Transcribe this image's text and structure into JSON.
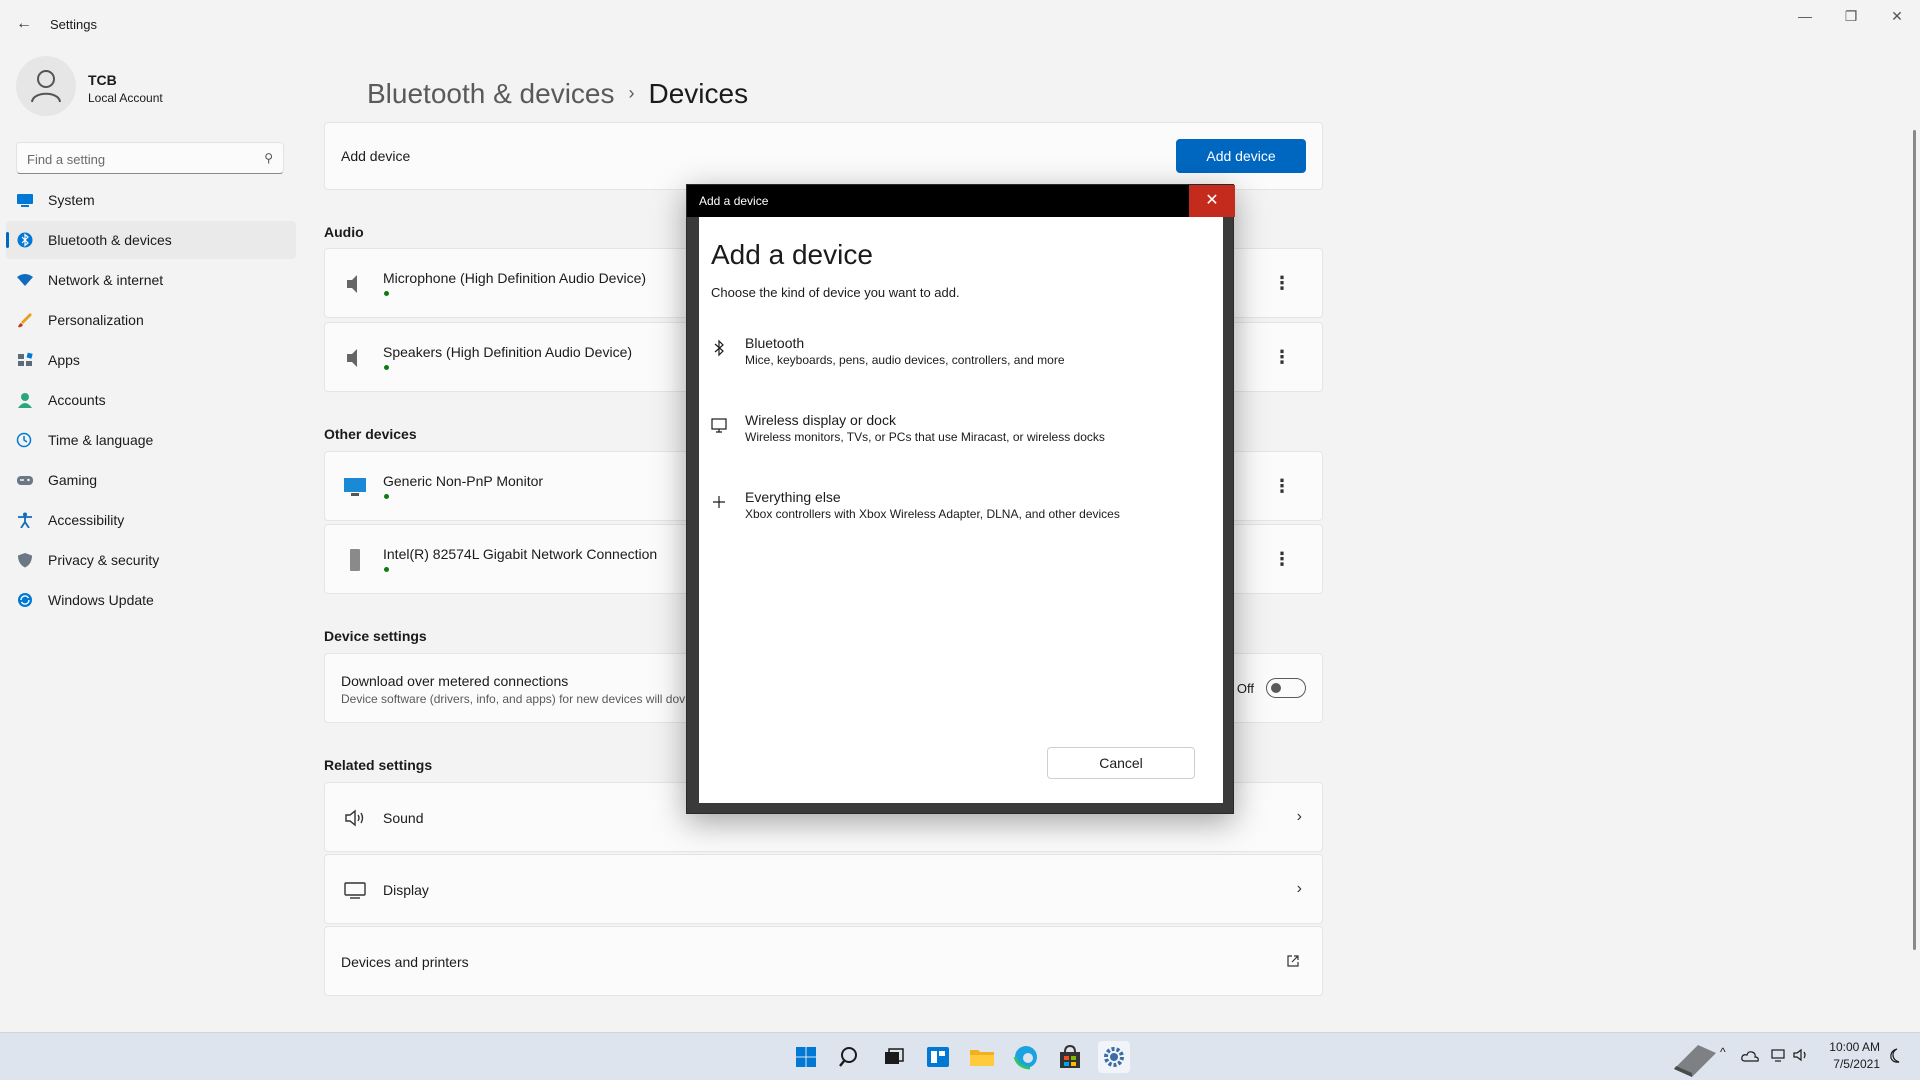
{
  "window": {
    "title": "Settings",
    "back_glyph": "←",
    "minimize_glyph": "—",
    "restore_glyph": "❐",
    "close_glyph": "✕"
  },
  "user": {
    "name": "TCB",
    "account_type": "Local Account"
  },
  "search": {
    "placeholder": "Find a setting",
    "icon_glyph": "⚲"
  },
  "sidebar": {
    "items": [
      {
        "label": "System",
        "icon": "monitor-icon",
        "color": "#0078d4"
      },
      {
        "label": "Bluetooth & devices",
        "icon": "bluetooth-icon",
        "color": "#0078d4",
        "active": true
      },
      {
        "label": "Network & internet",
        "icon": "wifi-icon",
        "color": "#0f6cbd"
      },
      {
        "label": "Personalization",
        "icon": "brush-icon",
        "color": "#e3a21a"
      },
      {
        "label": "Apps",
        "icon": "apps-icon",
        "color": "#5c6b7a"
      },
      {
        "label": "Accounts",
        "icon": "person-icon",
        "color": "#2aa77a"
      },
      {
        "label": "Time & language",
        "icon": "globe-clock-icon",
        "color": "#0078d4"
      },
      {
        "label": "Gaming",
        "icon": "gamepad-icon",
        "color": "#6b7785"
      },
      {
        "label": "Accessibility",
        "icon": "accessibility-icon",
        "color": "#0f6cbd"
      },
      {
        "label": "Privacy & security",
        "icon": "shield-icon",
        "color": "#6b7785"
      },
      {
        "label": "Windows Update",
        "icon": "update-icon",
        "color": "#0078d4"
      }
    ]
  },
  "breadcrumb": {
    "parent": "Bluetooth & devices",
    "separator": "›",
    "current": "Devices"
  },
  "add_device_card": {
    "label": "Add device",
    "button": "Add device"
  },
  "audio": {
    "heading": "Audio",
    "devices": [
      {
        "name": "Microphone (High Definition Audio Device)"
      },
      {
        "name": "Speakers (High Definition Audio Device)"
      }
    ]
  },
  "other_devices": {
    "heading": "Other devices",
    "devices": [
      {
        "name": "Generic Non-PnP Monitor"
      },
      {
        "name": "Intel(R) 82574L Gigabit Network Connection"
      }
    ]
  },
  "device_settings": {
    "heading": "Device settings",
    "metered_label": "Download over metered connections",
    "metered_desc": "Device software (drivers, info, and apps) for new devices will dov",
    "toggle_state": "Off"
  },
  "related_settings": {
    "heading": "Related settings",
    "items": [
      {
        "label": "Sound",
        "icon": "speaker-icon"
      },
      {
        "label": "Display",
        "icon": "display-icon"
      },
      {
        "label": "Devices and printers",
        "icon": "external-link-icon"
      }
    ]
  },
  "dialog": {
    "window_title": "Add a device",
    "close_glyph": "✕",
    "heading": "Add a device",
    "prompt": "Choose the kind of device you want to add.",
    "options": [
      {
        "title": "Bluetooth",
        "desc": "Mice, keyboards, pens, audio devices, controllers, and more",
        "icon": "bluetooth-icon"
      },
      {
        "title": "Wireless display or dock",
        "desc": "Wireless monitors, TVs, or PCs that use Miracast, or wireless docks",
        "icon": "monitor-icon",
        "glyph": "🖵"
      },
      {
        "title": "Everything else",
        "desc": "Xbox controllers with Xbox Wireless Adapter, DLNA, and other devices",
        "icon": "plus-icon",
        "glyph": "+"
      }
    ],
    "cancel": "Cancel"
  },
  "taskbar": {
    "icons": [
      "start-icon",
      "search-icon",
      "task-view-icon",
      "widgets-icon",
      "file-explorer-icon",
      "edge-icon",
      "store-icon",
      "settings-icon"
    ],
    "time": "10:00 AM",
    "date": "7/5/2021"
  },
  "colors": {
    "accent": "#0067c0",
    "close_red": "#c42b1c",
    "status_green": "#0f7b0f"
  }
}
